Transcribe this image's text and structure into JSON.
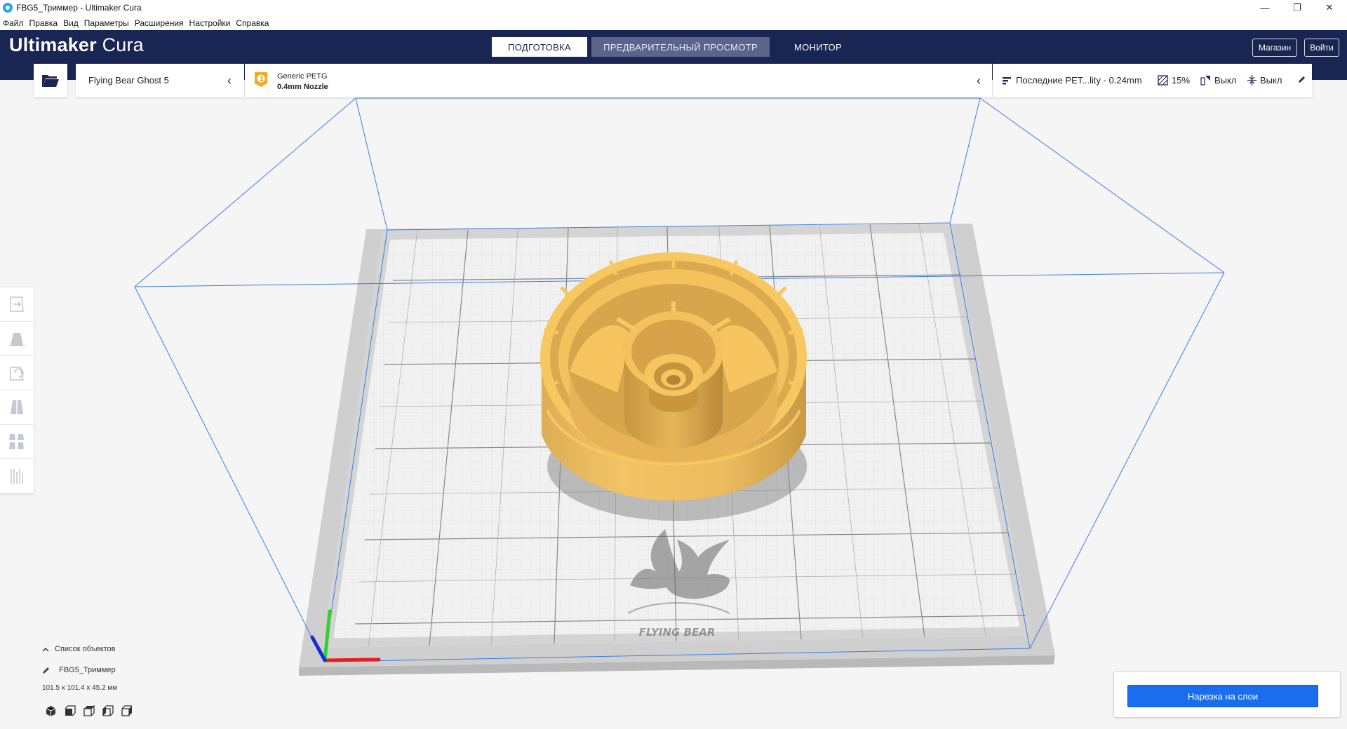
{
  "window": {
    "title": "FBG5_Триммер - Ultimaker Cura",
    "minimize_glyph": "—",
    "restore_glyph": "❐",
    "close_glyph": "✕"
  },
  "menu": [
    "Файл",
    "Правка",
    "Вид",
    "Параметры",
    "Расширения",
    "Настройки",
    "Справка"
  ],
  "header": {
    "logo_bold": "Ultimaker",
    "logo_light": "Cura",
    "tabs": [
      {
        "label": "ПОДГОТОВКА",
        "state": "active"
      },
      {
        "label": "ПРЕДВАРИТЕЛЬНЫЙ ПРОСМОТР",
        "state": "hover"
      },
      {
        "label": "МОНИТОР",
        "state": "normal"
      }
    ],
    "marketplace_label": "Магазин",
    "signin_label": "Войти"
  },
  "printer": {
    "name": "Flying Bear Ghost 5"
  },
  "material": {
    "extruder_index": "1",
    "name": "Generic PETG",
    "nozzle": "0.4mm Nozzle",
    "badge_color": "#f5a91f"
  },
  "print_settings": {
    "profile": "Последние PET...lity - 0.24mm",
    "infill": "15%",
    "support": "Выкл",
    "adhesion": "Выкл"
  },
  "tools": [
    "move-tool",
    "scale-tool",
    "rotate-tool",
    "mirror-tool",
    "per-model-settings-tool",
    "support-blocker-tool"
  ],
  "object_list": {
    "header": "Список объектов",
    "object_name": "FBG5_Триммер",
    "dimensions": "101.5 x 101.4 x 45.2 мм"
  },
  "bed": {
    "brand_text": "FLYING BEAR"
  },
  "slice": {
    "button_label": "Нарезка на слои"
  },
  "colors": {
    "header_bg": "#192552",
    "model_fill": "#f6c35a",
    "accent_blue": "#196ef0",
    "build_volume_line": "#3a7ee6"
  }
}
